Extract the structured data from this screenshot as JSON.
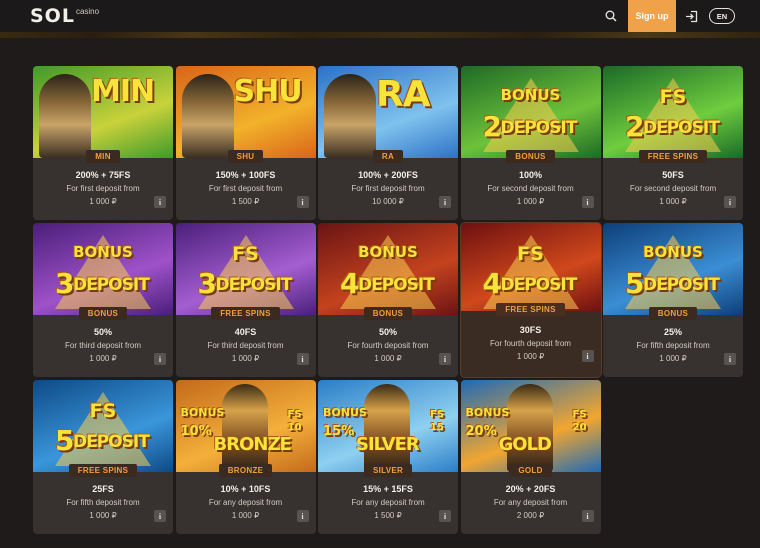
{
  "header": {
    "logo_main": "SOL",
    "logo_sub": "casino",
    "search_icon": "search-icon",
    "signup_label": "Sign up",
    "login_icon": "login-icon",
    "lang_label": "EN"
  },
  "cards": [
    {
      "art": "MIN",
      "tag": "MIN",
      "title": "200% + 75FS",
      "desc": "For first deposit from",
      "amount": "1 000 ₽",
      "bg": [
        "#3f9a2a",
        "#c9d23a"
      ]
    },
    {
      "art": "SHU",
      "tag": "SHU",
      "title": "150% + 100FS",
      "desc": "For first deposit from",
      "amount": "1 500 ₽",
      "bg": [
        "#d9641a",
        "#f2b22a"
      ]
    },
    {
      "art": "RA",
      "tag": "RA",
      "title": "100% + 200FS",
      "desc": "For first deposit from",
      "amount": "10 000 ₽",
      "bg": [
        "#2c72c6",
        "#7fc2ee"
      ]
    },
    {
      "art_top": "BONUS",
      "art_num": "2",
      "art_bottom": "DEPOSIT",
      "tag": "BONUS",
      "title": "100%",
      "desc": "For second deposit from",
      "amount": "1 000 ₽",
      "bg": [
        "#1c6a26",
        "#6dc23a"
      ]
    },
    {
      "art_top": "FS",
      "art_num": "2",
      "art_bottom": "DEPOSIT",
      "tag": "FREE SPINS",
      "title": "50FS",
      "desc": "For second deposit from",
      "amount": "1 000 ₽",
      "bg": [
        "#1a6a28",
        "#6fcd3e"
      ]
    },
    {
      "art_top": "BONUS",
      "art_num": "3",
      "art_bottom": "DEPOSIT",
      "tag": "BONUS",
      "title": "50%",
      "desc": "For third deposit from",
      "amount": "1 000 ₽",
      "bg": [
        "#4a1e7a",
        "#9e52c8"
      ]
    },
    {
      "art_top": "FS",
      "art_num": "3",
      "art_bottom": "DEPOSIT",
      "tag": "FREE SPINS",
      "title": "40FS",
      "desc": "For third deposit from",
      "amount": "1 000 ₽",
      "bg": [
        "#4b1f7c",
        "#a45ed0"
      ]
    },
    {
      "art_top": "BONUS",
      "art_num": "4",
      "art_bottom": "DEPOSIT",
      "tag": "BONUS",
      "title": "50%",
      "desc": "For fourth deposit from",
      "amount": "1 000 ₽",
      "bg": [
        "#6a1414",
        "#c4421e"
      ]
    },
    {
      "art_top": "FS",
      "art_num": "4",
      "art_bottom": "DEPOSIT",
      "tag": "FREE SPINS",
      "title": "30FS",
      "desc": "For fourth deposit from",
      "amount": "1 000 ₽",
      "bg": [
        "#6e1010",
        "#d0481c"
      ],
      "highlight": true
    },
    {
      "art_top": "BONUS",
      "art_num": "5",
      "art_bottom": "DEPOSIT",
      "tag": "BONUS",
      "title": "25%",
      "desc": "For fifth deposit from",
      "amount": "1 000 ₽",
      "bg": [
        "#0e3e7a",
        "#3a8ed4"
      ]
    },
    {
      "art_top": "FS",
      "art_num": "5",
      "art_bottom": "DEPOSIT",
      "tag": "FREE SPINS",
      "title": "25FS",
      "desc": "For fifth deposit from",
      "amount": "1 000 ₽",
      "bg": [
        "#0e4a86",
        "#3a96da"
      ]
    },
    {
      "art_top": "BONUS",
      "art_pct": "10%",
      "art_bottom": "BRONZE",
      "art_fs": "FS 10",
      "tag": "BRONZE",
      "title": "10% + 10FS",
      "desc": "For any deposit from",
      "amount": "1 000 ₽",
      "bg": [
        "#c46a1c",
        "#f3b03a"
      ]
    },
    {
      "art_top": "BONUS",
      "art_pct": "15%",
      "art_bottom": "SILVER",
      "art_fs": "FS 15",
      "tag": "SILVER",
      "title": "15% + 15FS",
      "desc": "For any deposit from",
      "amount": "1 500 ₽",
      "bg": [
        "#2a7ec8",
        "#8fd0f0"
      ]
    },
    {
      "art_top": "BONUS",
      "art_pct": "20%",
      "art_bottom": "GOLD",
      "art_fs": "FS 20",
      "tag": "GOLD",
      "title": "20% + 20FS",
      "desc": "For any deposit from",
      "amount": "2 000 ₽",
      "bg": [
        "#1e6ab6",
        "#f2a630"
      ]
    }
  ],
  "info_label": "i",
  "colors": {
    "accent": "#f0a24a",
    "tag_text": "#f09f3e",
    "card_bg": "#37322f",
    "page_bg": "#1f1b1a"
  }
}
